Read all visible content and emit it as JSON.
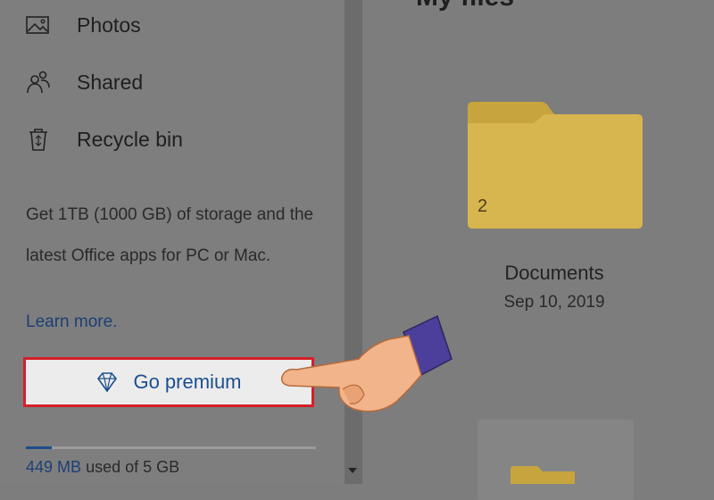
{
  "sidebar": {
    "items": [
      {
        "label": "Photos",
        "icon": "photo-icon"
      },
      {
        "label": "Shared",
        "icon": "people-icon"
      },
      {
        "label": "Recycle bin",
        "icon": "recycle-bin-icon"
      }
    ],
    "promo_text": "Get 1TB (1000 GB) of storage and the latest Office apps for PC or Mac.",
    "learn_more": "Learn more.",
    "premium_button": {
      "label": "Go premium",
      "icon": "diamond-icon"
    },
    "storage": {
      "used": "449 MB",
      "suffix": "used of 5 GB",
      "fraction": 0.09
    }
  },
  "main": {
    "title": "My files",
    "folders": [
      {
        "name": "Documents",
        "date": "Sep 10, 2019",
        "count": "2"
      }
    ]
  },
  "colors": {
    "accent": "#1d4f8f",
    "highlight_border": "#d4202a",
    "folder": "#cfae45"
  }
}
